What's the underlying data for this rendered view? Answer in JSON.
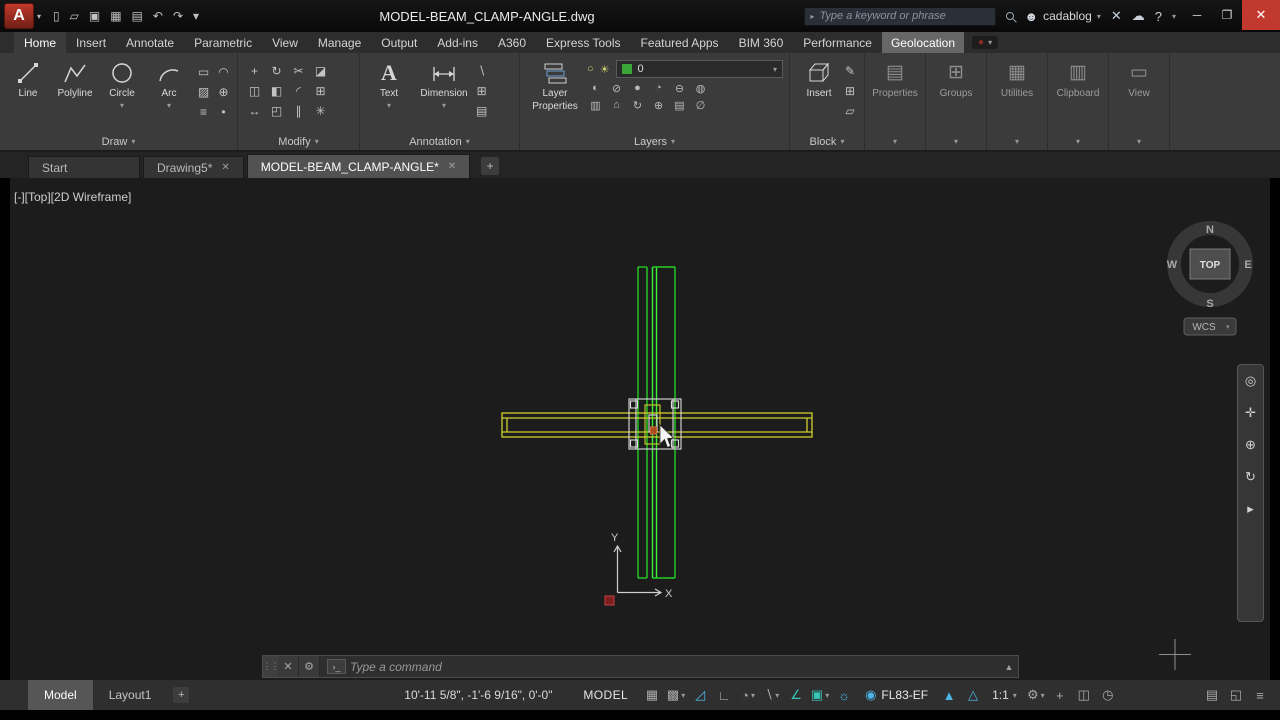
{
  "colors": {
    "accent_blue": "#4db5e6",
    "teal": "#35c4b5",
    "cad_green": "#23cf23",
    "cad_yellow": "#cfcf2e",
    "close_red": "#c1392e"
  },
  "title_bar": {
    "logo_letter": "A",
    "title": "MODEL-BEAM_CLAMP-ANGLE.dwg",
    "search_placeholder": "Type a keyword or phrase",
    "account_name": "cadablog",
    "help_label": "?"
  },
  "qat": {
    "icons": [
      {
        "name": "new-file",
        "glyph": "▯"
      },
      {
        "name": "open-file",
        "glyph": "▱"
      },
      {
        "name": "save",
        "glyph": "▣"
      },
      {
        "name": "save-as",
        "glyph": "▦"
      },
      {
        "name": "plot",
        "glyph": "▤"
      },
      {
        "name": "undo",
        "glyph": "↶"
      },
      {
        "name": "redo",
        "glyph": "↷"
      },
      {
        "name": "qat-menu",
        "glyph": "▾"
      }
    ]
  },
  "ribbon_tabs": [
    "Home",
    "Insert",
    "Annotate",
    "Parametric",
    "View",
    "Manage",
    "Output",
    "Add-ins",
    "A360",
    "Express Tools",
    "Featured Apps",
    "BIM 360",
    "Performance",
    "Geolocation"
  ],
  "ribbon": {
    "draw": {
      "label": "Draw",
      "buttons": [
        {
          "label": "Line"
        },
        {
          "label": "Polyline"
        },
        {
          "label": "Circle"
        },
        {
          "label": "Arc"
        }
      ],
      "mini_icons": [
        {
          "name": "rectangle",
          "glyph": "▭"
        },
        {
          "name": "ellipse",
          "glyph": "◠"
        },
        {
          "name": "hatch",
          "glyph": "▨"
        },
        {
          "name": "gradient",
          "glyph": "⊕"
        },
        {
          "name": "boundary",
          "glyph": "≡"
        },
        {
          "name": "point",
          "glyph": "•"
        }
      ]
    },
    "modify": {
      "label": "Modify",
      "mini_icons": [
        {
          "name": "move",
          "glyph": "+"
        },
        {
          "name": "rotate",
          "glyph": "↻"
        },
        {
          "name": "trim",
          "glyph": "✂"
        },
        {
          "name": "erase",
          "glyph": "◪"
        },
        {
          "name": "copy",
          "glyph": "◫"
        },
        {
          "name": "mirror",
          "glyph": "◧"
        },
        {
          "name": "fillet",
          "glyph": "◜"
        },
        {
          "name": "array",
          "glyph": "⊞"
        },
        {
          "name": "stretch",
          "glyph": "↔"
        },
        {
          "name": "scale",
          "glyph": "◰"
        },
        {
          "name": "offset",
          "glyph": "∥"
        },
        {
          "name": "explode",
          "glyph": "✳"
        }
      ]
    },
    "annotation": {
      "label": "Annotation",
      "buttons": [
        {
          "label": "Text"
        },
        {
          "label": "Dimension"
        }
      ],
      "mini_icons": [
        {
          "name": "leader",
          "glyph": "∖"
        },
        {
          "name": "table",
          "glyph": "⊞"
        },
        {
          "name": "markup",
          "glyph": "▤"
        }
      ]
    },
    "layers": {
      "label": "Layers",
      "big_button": {
        "line1": "Layer",
        "line2": "Properties"
      },
      "current_layer": "0",
      "top_icons": [
        {
          "name": "layer-off",
          "glyph": "○"
        },
        {
          "name": "layer-isolate",
          "glyph": "☀"
        }
      ],
      "mini_icons": [
        {
          "name": "layer-freeze",
          "glyph": "◐"
        },
        {
          "name": "layer-lock",
          "glyph": "⊘"
        },
        {
          "name": "layer-on",
          "glyph": "●"
        },
        {
          "name": "layer-match",
          "glyph": "◔"
        },
        {
          "name": "layer-prev",
          "glyph": "⊖"
        },
        {
          "name": "layer-states",
          "glyph": "◍"
        },
        {
          "name": "layer-walk",
          "glyph": "▥"
        },
        {
          "name": "layer-current",
          "glyph": "⌂"
        },
        {
          "name": "layer-restore",
          "glyph": "↻"
        },
        {
          "name": "layer-merge",
          "glyph": "⊕"
        },
        {
          "name": "layer-copy",
          "glyph": "▤"
        },
        {
          "name": "layer-delete",
          "glyph": "∅"
        }
      ]
    },
    "block": {
      "label": "Block",
      "big_button": "Insert",
      "mini_icons": [
        {
          "name": "edit-block",
          "glyph": "✎"
        },
        {
          "name": "create-block",
          "glyph": "⊞"
        },
        {
          "name": "block-attributes",
          "glyph": "▱"
        }
      ]
    },
    "collapsed_panels": [
      {
        "label": "Properties",
        "glyph": "▤"
      },
      {
        "label": "Groups",
        "glyph": "⊞"
      },
      {
        "label": "Utilities",
        "glyph": "▦"
      },
      {
        "label": "Clipboard",
        "glyph": "▥"
      },
      {
        "label": "View",
        "glyph": "▭"
      }
    ]
  },
  "file_tabs": [
    {
      "label": "Start"
    },
    {
      "label": "Drawing5*"
    },
    {
      "label": "MODEL-BEAM_CLAMP-ANGLE*"
    }
  ],
  "viewport": {
    "controls_label": "[-][Top][2D Wireframe]",
    "viewcube": {
      "north": "N",
      "south": "S",
      "east": "E",
      "west": "W",
      "face": "TOP",
      "wcs": "WCS"
    },
    "ucs": {
      "x_label": "X",
      "y_label": "Y"
    }
  },
  "navbar_icons": [
    {
      "name": "full-navigation-wheel",
      "glyph": "◎"
    },
    {
      "name": "pan",
      "glyph": "✛"
    },
    {
      "name": "zoom",
      "glyph": "⊕"
    },
    {
      "name": "orbit",
      "glyph": "↻"
    },
    {
      "name": "showmotion",
      "glyph": "▸"
    }
  ],
  "command_line": {
    "prompt_placeholder": "Type a command",
    "badge": "›_"
  },
  "status_bar": {
    "model_tab": "Model",
    "layout_tab": "Layout1",
    "coordinates": "10'-11 5/8\", -1'-6 9/16\", 0'-0\"",
    "space_button": "MODEL",
    "geolocation": "FL83-EF",
    "annotation_scale": "1:1",
    "icons": [
      {
        "name": "grid-display",
        "glyph": "▦"
      },
      {
        "name": "snap-mode",
        "glyph": "▩"
      },
      {
        "name": "infer-constraints",
        "glyph": "◿"
      },
      {
        "name": "ortho-mode",
        "glyph": "∟"
      },
      {
        "name": "polar-tracking",
        "glyph": "◔"
      },
      {
        "name": "isometric-drafting",
        "glyph": "∖"
      },
      {
        "name": "osnap-tracking",
        "glyph": "∠"
      },
      {
        "name": "object-snap",
        "glyph": "▣"
      },
      {
        "name": "show-annotation-objects",
        "glyph": "☼"
      },
      {
        "name": "annotation-visibility",
        "glyph": "▲"
      },
      {
        "name": "annotation-autoscale",
        "glyph": "△"
      },
      {
        "name": "workspace-switching",
        "glyph": "⚙"
      },
      {
        "name": "annotation-monitor",
        "glyph": "+"
      },
      {
        "name": "isolate-objects",
        "glyph": "◫"
      },
      {
        "name": "graphics-performance",
        "glyph": "◷"
      },
      {
        "name": "tray-plot",
        "glyph": "▤"
      },
      {
        "name": "clean-screen",
        "glyph": "◱"
      },
      {
        "name": "customization",
        "glyph": "≡"
      }
    ]
  }
}
